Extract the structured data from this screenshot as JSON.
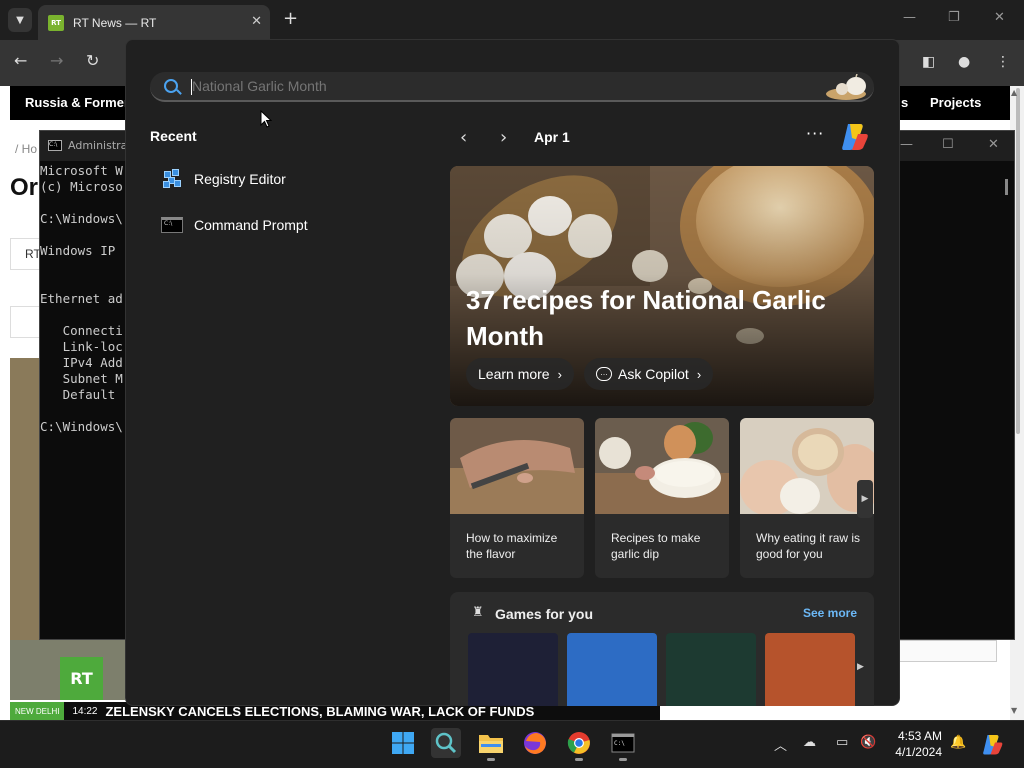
{
  "browser": {
    "tab_title": "RT News — RT",
    "favicon_text": "RT",
    "nav_items": [
      "Russia & Former",
      "s",
      "Projects"
    ],
    "breadcrumb": "/ Ho",
    "heading_fragment": "Or",
    "tab_fragment": "RT"
  },
  "ticker": {
    "location": "NEW DELHI",
    "time": "14:22",
    "headline": "ZELENSKY CANCELS ELECTIONS, BLAMING WAR, LACK OF FUNDS"
  },
  "rt_logo": "RT",
  "cmd": {
    "title": "Administra",
    "lines": [
      "Microsoft W",
      "(c) Microso",
      "",
      "C:\\Windows\\",
      "",
      "Windows IP ",
      "",
      "",
      "Ethernet ad",
      "",
      "   Connecti",
      "   Link-loc",
      "   IPv4 Add",
      "   Subnet M",
      "   Default ",
      "",
      "C:\\Windows\\"
    ]
  },
  "search": {
    "placeholder": "National Garlic Month"
  },
  "recent": {
    "heading": "Recent",
    "items": [
      {
        "label": "Registry Editor",
        "icon": "registry-editor-icon"
      },
      {
        "label": "Command Prompt",
        "icon": "command-prompt-icon"
      }
    ]
  },
  "highlights": {
    "date": "Apr 1",
    "more": "···",
    "hero_title": "37 recipes for National Garlic Month",
    "learn_more": "Learn more",
    "ask_copilot": "Ask Copilot",
    "cards": [
      {
        "text": "How to maximize the flavor"
      },
      {
        "text": "Recipes to make garlic dip"
      },
      {
        "text": "Why eating it raw is good for you"
      }
    ],
    "games_heading": "Games for you",
    "see_more": "See more"
  },
  "taskbar": {
    "time": "4:53 AM",
    "date": "4/1/2024",
    "apps": [
      "start-button",
      "search-button",
      "file-explorer",
      "firefox",
      "chrome",
      "terminal"
    ]
  },
  "colors": {
    "accent": "#4ba3f0",
    "link": "#6cb8f6",
    "rt_green": "#4eaa3c"
  }
}
